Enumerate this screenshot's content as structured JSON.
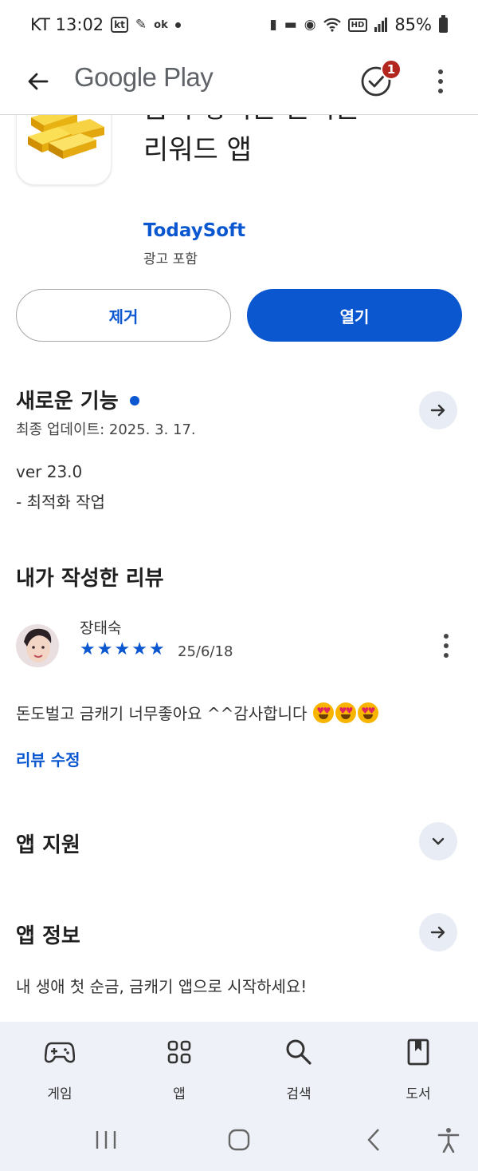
{
  "status_bar": {
    "carrier_time": "KT 13:02",
    "battery": "85%",
    "icons": [
      "kt-icon",
      "messenger-icon",
      "ok-icon",
      "dot-icon",
      "sleep-icon",
      "bed-icon",
      "alarm-icon",
      "wifi-icon",
      "hd-icon",
      "signal-icon",
      "battery-icon"
    ]
  },
  "app_bar": {
    "title": "Google Play",
    "updates_badge": "1"
  },
  "app": {
    "name_lines": [
      "금이 쌓이는 돈버는",
      "리워드 앱"
    ],
    "developer": "TodaySoft",
    "ads_label": "광고 포함",
    "uninstall_label": "제거",
    "open_label": "열기"
  },
  "whats_new": {
    "title": "새로운 기능",
    "last_updated": "최종 업데이트: 2025. 3. 17.",
    "version": "ver 23.0",
    "note": "- 최적화 작업"
  },
  "my_review": {
    "title": "내가 작성한 리뷰",
    "reviewer": "장태숙",
    "rating": 5,
    "rating_max": 5,
    "date": "25/6/18",
    "text": "돈도벌고 금캐기 너무좋아요 ^^감사합니다",
    "emoji_count": 3,
    "edit_label": "리뷰 수정"
  },
  "app_support": {
    "title": "앱 지원"
  },
  "about": {
    "title": "앱 정보",
    "description": "내 생애 첫 순금, 금캐기 앱으로 시작하세요!"
  },
  "bottom_nav": {
    "items": [
      {
        "label": "게임",
        "icon": "gamepad-icon"
      },
      {
        "label": "앱",
        "icon": "apps-grid-icon"
      },
      {
        "label": "검색",
        "icon": "search-icon"
      },
      {
        "label": "도서",
        "icon": "book-icon"
      }
    ]
  },
  "colors": {
    "accent": "#0b57d0",
    "badge": "#b3261e",
    "nav_background": "#eef1f7",
    "round_button": "#e8ecf4"
  }
}
